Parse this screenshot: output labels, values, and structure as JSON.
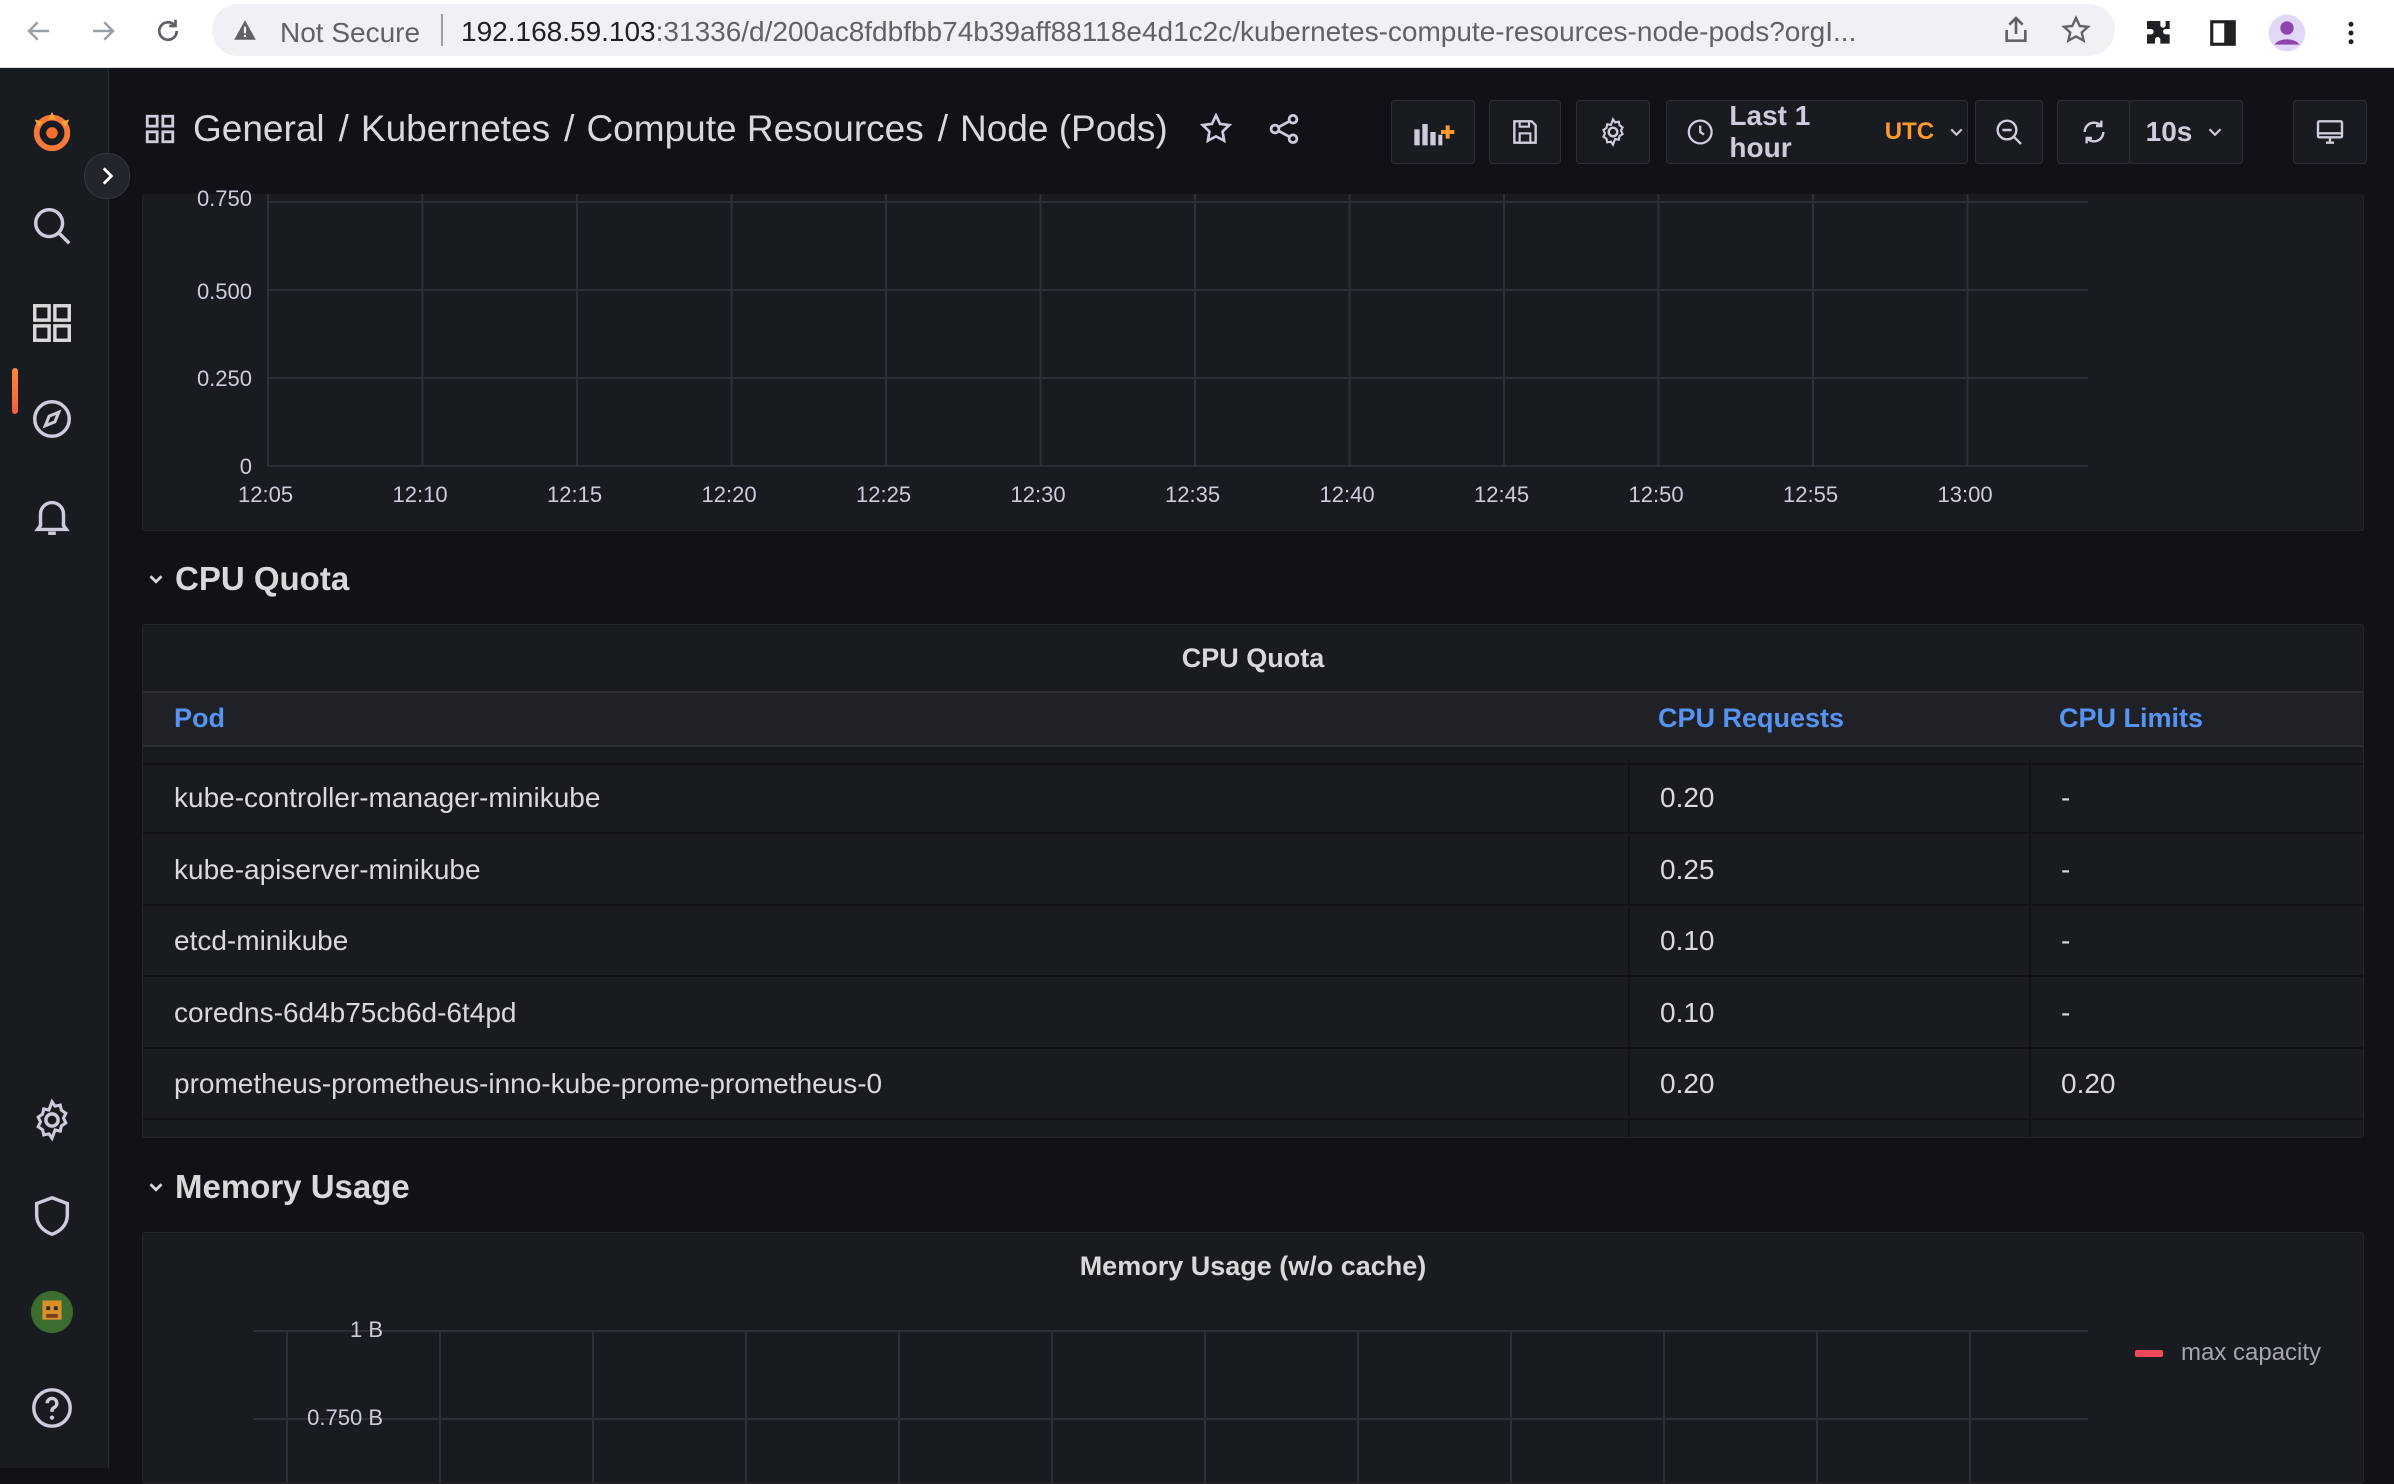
{
  "browser": {
    "security_label": "Not Secure",
    "url_host": "192.168.59.103",
    "url_rest": ":31336/d/200ac8fdbfbb74b39aff88118e4d1c2c/kubernetes-compute-resources-node-pods?orgI..."
  },
  "breadcrumb": {
    "items": [
      "General",
      "Kubernetes",
      "Compute Resources",
      "Node (Pods)"
    ]
  },
  "toolbar": {
    "time_range": "Last 1 hour",
    "timezone": "UTC",
    "refresh_interval": "10s"
  },
  "cpu_usage_chart": {
    "y_ticks": [
      "0.750",
      "0.500",
      "0.250",
      "0"
    ],
    "x_ticks": [
      "12:05",
      "12:10",
      "12:15",
      "12:20",
      "12:25",
      "12:30",
      "12:35",
      "12:40",
      "12:45",
      "12:50",
      "12:55",
      "13:00"
    ]
  },
  "cpu_quota_row": {
    "title": "CPU Quota",
    "panel_title": "CPU Quota",
    "columns": [
      "Pod",
      "CPU Requests",
      "CPU Limits"
    ],
    "rows": [
      {
        "pod": "kube-controller-manager-minikube",
        "requests": "0.20",
        "limits": "-"
      },
      {
        "pod": "kube-apiserver-minikube",
        "requests": "0.25",
        "limits": "-"
      },
      {
        "pod": "etcd-minikube",
        "requests": "0.10",
        "limits": "-"
      },
      {
        "pod": "coredns-6d4b75cb6d-6t4pd",
        "requests": "0.10",
        "limits": "-"
      },
      {
        "pod": "prometheus-prometheus-inno-kube-prome-prometheus-0",
        "requests": "0.20",
        "limits": "0.20"
      }
    ]
  },
  "memory_row": {
    "title": "Memory Usage",
    "panel_title": "Memory Usage (w/o cache)",
    "y_ticks": [
      "1 B",
      "0.750 B"
    ],
    "legend": "max capacity",
    "legend_color": "#f2495c"
  },
  "colors": {
    "background": "#111217",
    "panel": "#181b1f",
    "accent": "#5794f2",
    "brand": "#f55f3e",
    "timezone": "#ff9830"
  }
}
